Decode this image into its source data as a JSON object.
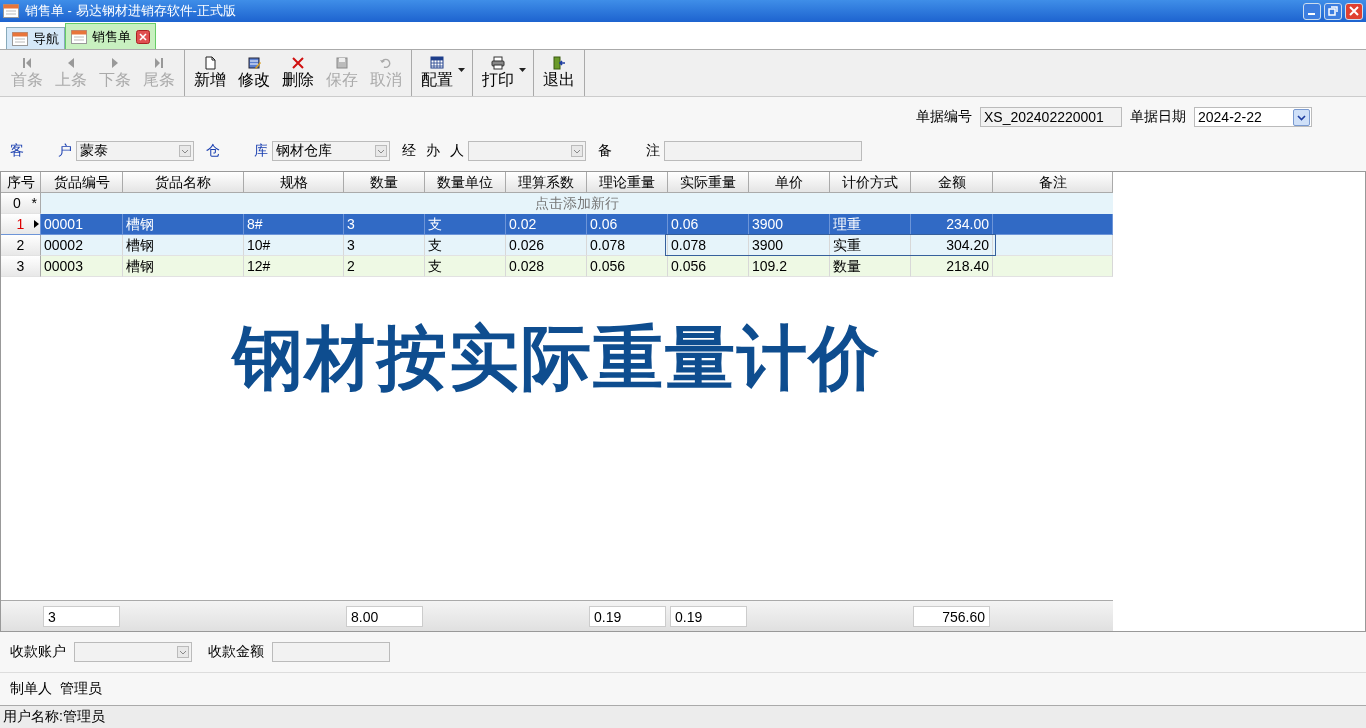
{
  "window": {
    "title": "销售单 - 易达钢材进销存软件-正式版"
  },
  "tabs": [
    {
      "label": "导航",
      "selected": false,
      "closable": false
    },
    {
      "label": "销售单",
      "selected": true,
      "closable": true
    }
  ],
  "toolbar": {
    "groups": [
      [
        {
          "label": "首条",
          "disabled": true,
          "dropdown": false
        },
        {
          "label": "上条",
          "disabled": true,
          "dropdown": false
        },
        {
          "label": "下条",
          "disabled": true,
          "dropdown": false
        },
        {
          "label": "尾条",
          "disabled": true,
          "dropdown": false
        }
      ],
      [
        {
          "label": "新增",
          "disabled": false,
          "dropdown": false
        },
        {
          "label": "修改",
          "disabled": false,
          "dropdown": false
        },
        {
          "label": "删除",
          "disabled": false,
          "dropdown": false
        },
        {
          "label": "保存",
          "disabled": true,
          "dropdown": false
        },
        {
          "label": "取消",
          "disabled": true,
          "dropdown": false
        }
      ],
      [
        {
          "label": "配置",
          "disabled": false,
          "dropdown": true
        }
      ],
      [
        {
          "label": "打印",
          "disabled": false,
          "dropdown": true
        }
      ],
      [
        {
          "label": "退出",
          "disabled": false,
          "dropdown": false
        }
      ]
    ]
  },
  "document": {
    "number_label": "单据编号",
    "number": "XS_202402220001",
    "date_label": "单据日期",
    "date": "2024-2-22"
  },
  "header_fields": [
    {
      "kind": "combo",
      "label": "客户",
      "required": true,
      "value": "蒙泰"
    },
    {
      "kind": "combo",
      "label": "仓库",
      "required": true,
      "value": "钢材仓库"
    },
    {
      "kind": "combo",
      "label": "经办人",
      "required": false
    },
    {
      "kind": "text",
      "label": "备注",
      "required": false
    }
  ],
  "table": {
    "columns": [
      {
        "label": "序号"
      },
      {
        "label": "货品编号",
        "total": "3"
      },
      {
        "label": "货品名称"
      },
      {
        "label": "规格"
      },
      {
        "label": "数量",
        "total": "8.00"
      },
      {
        "label": "数量单位"
      },
      {
        "label": "理算系数"
      },
      {
        "label": "理论重量",
        "total": "0.19"
      },
      {
        "label": "实际重量",
        "total": "0.19"
      },
      {
        "label": "单价"
      },
      {
        "label": "计价方式"
      },
      {
        "label": "金额",
        "total": "756.60"
      },
      {
        "label": "备注"
      }
    ],
    "new_row": {
      "seq": "0",
      "marker": "*",
      "prompt": "点击添加新行"
    },
    "rows": [
      {
        "selected": true,
        "current": true,
        "edit_focus": false,
        "cells": [
          "1",
          "00001",
          "槽钢",
          "8#",
          "3",
          "支",
          "0.02",
          "0.06",
          "0.06",
          "3900",
          "理重",
          "234.00"
        ]
      },
      {
        "selected": false,
        "current": false,
        "edit_focus": true,
        "cells": [
          "2",
          "00002",
          "槽钢",
          "10#",
          "3",
          "支",
          "0.026",
          "0.078",
          "0.078",
          "3900",
          "实重",
          "304.20"
        ]
      },
      {
        "selected": false,
        "current": false,
        "edit_focus": false,
        "cells": [
          "3",
          "00003",
          "槽钢",
          "12#",
          "2",
          "支",
          "0.028",
          "0.056",
          "0.056",
          "109.2",
          "数量",
          "218.40"
        ]
      }
    ]
  },
  "caption": "钢材按实际重量计价",
  "payment": {
    "account_label": "收款账户",
    "amount_label": "收款金额"
  },
  "maker": {
    "label": "制单人",
    "value": "管理员"
  },
  "status_bar": "用户名称:管理员"
}
